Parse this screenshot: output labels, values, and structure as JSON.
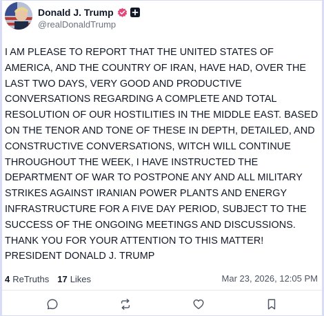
{
  "author": {
    "display_name": "Donald J. Trump",
    "handle": "@realDonaldTrump",
    "verified_icon": "verified-badge-icon",
    "plus_icon": "truth-plus-icon",
    "verified_color": "#e04a7a"
  },
  "post": {
    "text": "I AM PLEASE TO REPORT THAT THE UNITED STATES OF\nAMERICA, AND THE COUNTRY OF IRAN, HAVE HAD, OVER THE\nLAST TWO DAYS, VERY GOOD AND PRODUCTIVE\nCONVERSATIONS REGARDING A COMPLETE AND TOTAL\nRESOLUTION OF OUR HOSTILITIES IN THE MIDDLE EAST. BASED\nON THE TENOR AND TONE OF THESE IN DEPTH, DETAILED, AND\nCONSTRUCTIVE CONVERSATIONS, WITCH WILL CONTINUE\nTHROUGHOUT THE WEEK, I HAVE INSTRUCTED THE\nDEPARTMENT OF WAR TO POSTPONE ANY AND ALL MILITARY\nSTRIKES AGAINST IRANIAN POWER PLANTS AND ENERGY\nINFRASTRUCTURE FOR A FIVE DAY PERIOD, SUBJECT TO THE\nSUCCESS OF THE ONGOING MEETINGS AND DISCUSSIONS.\nTHANK YOU FOR YOUR ATTENTION TO THIS MATTER!\nPRESIDENT DONALD J. TRUMP",
    "retruths_count": "4",
    "retruths_label": "ReTruths",
    "likes_count": "17",
    "likes_label": "Likes",
    "timestamp": "Mar 23, 2026, 12:05 PM"
  },
  "actions": [
    {
      "icon": "reply-icon"
    },
    {
      "icon": "retruth-icon"
    },
    {
      "icon": "like-heart-icon"
    },
    {
      "icon": "bookmark-icon"
    }
  ]
}
